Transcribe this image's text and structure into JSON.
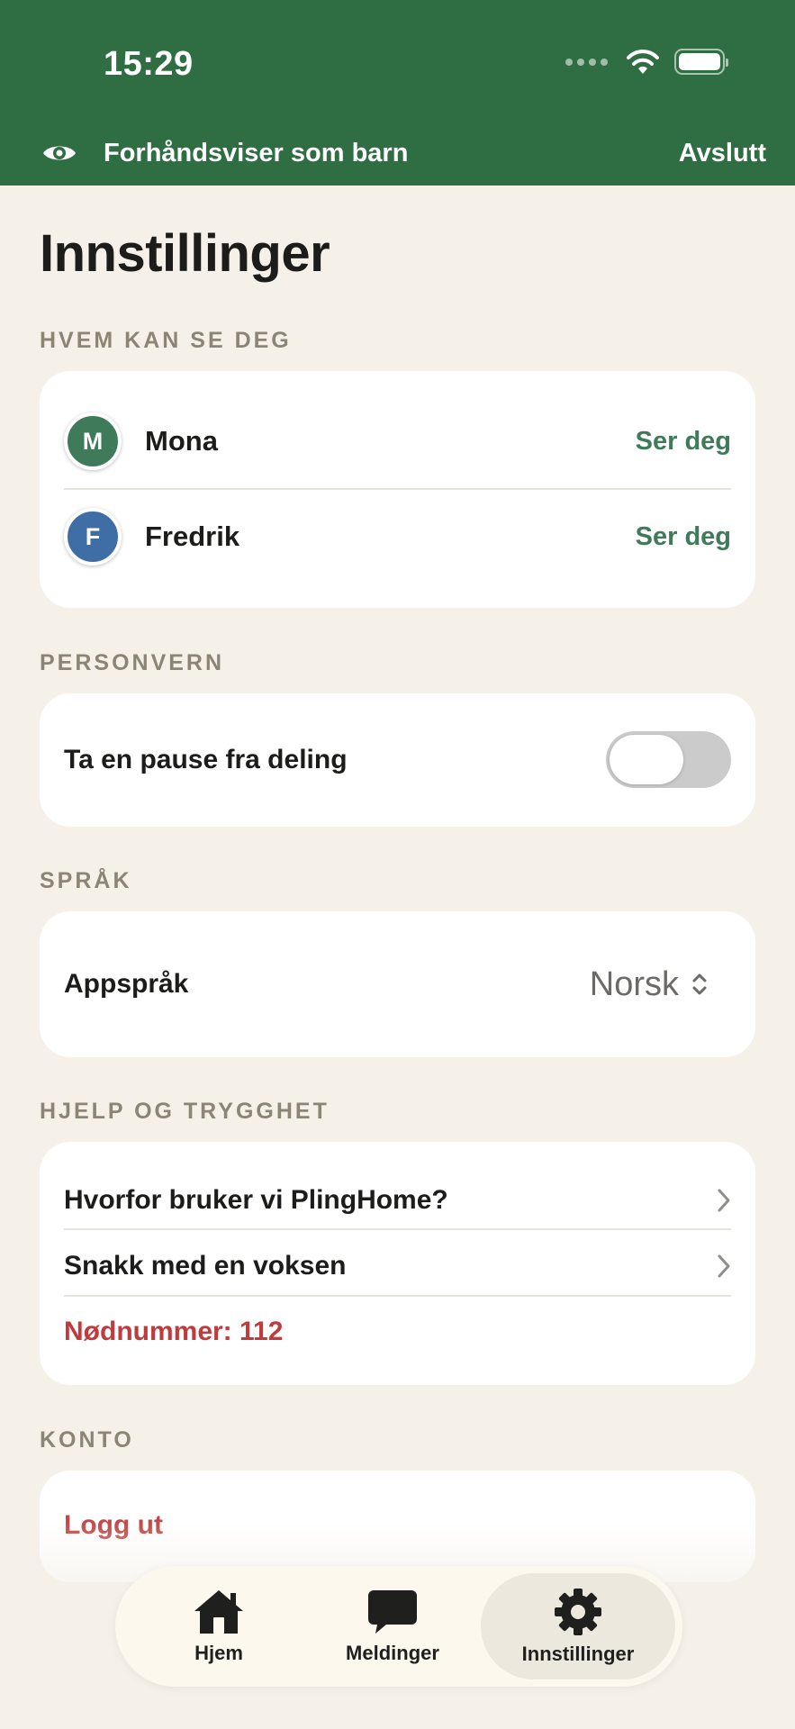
{
  "status_bar": {
    "time": "15:29"
  },
  "preview_banner": {
    "text": "Forhåndsviser som barn",
    "exit_label": "Avslutt"
  },
  "page": {
    "title": "Innstillinger"
  },
  "sections": {
    "who_sees_you": {
      "label": "HVEM KAN SE DEG",
      "people": [
        {
          "initial": "M",
          "name": "Mona",
          "status": "Ser deg",
          "avatar_color": "#3f7a5b"
        },
        {
          "initial": "F",
          "name": "Fredrik",
          "status": "Ser deg",
          "avatar_color": "#3f6ea6"
        }
      ]
    },
    "privacy": {
      "label": "PERSONVERN",
      "pause_sharing_label": "Ta en pause fra deling",
      "pause_sharing_on": false
    },
    "language": {
      "label": "SPRÅK",
      "app_language_label": "Appspråk",
      "app_language_value": "Norsk"
    },
    "help": {
      "label": "HJELP OG TRYGGHET",
      "items": [
        "Hvorfor bruker vi PlingHome?",
        "Snakk med en voksen"
      ],
      "emergency": "Nødnummer: 112"
    },
    "account": {
      "label": "KONTO",
      "logout_label": "Logg ut"
    }
  },
  "tab_bar": {
    "tabs": [
      {
        "label": "Hjem",
        "icon": "house-icon",
        "active": false
      },
      {
        "label": "Meldinger",
        "icon": "chat-bubble-icon",
        "active": false
      },
      {
        "label": "Innstillinger",
        "icon": "gear-icon",
        "active": true
      }
    ]
  },
  "colors": {
    "header_green": "#2f6e43",
    "background": "#f5f1e9",
    "accent_green": "#3f7a5b",
    "danger_red": "#c03c3c"
  }
}
